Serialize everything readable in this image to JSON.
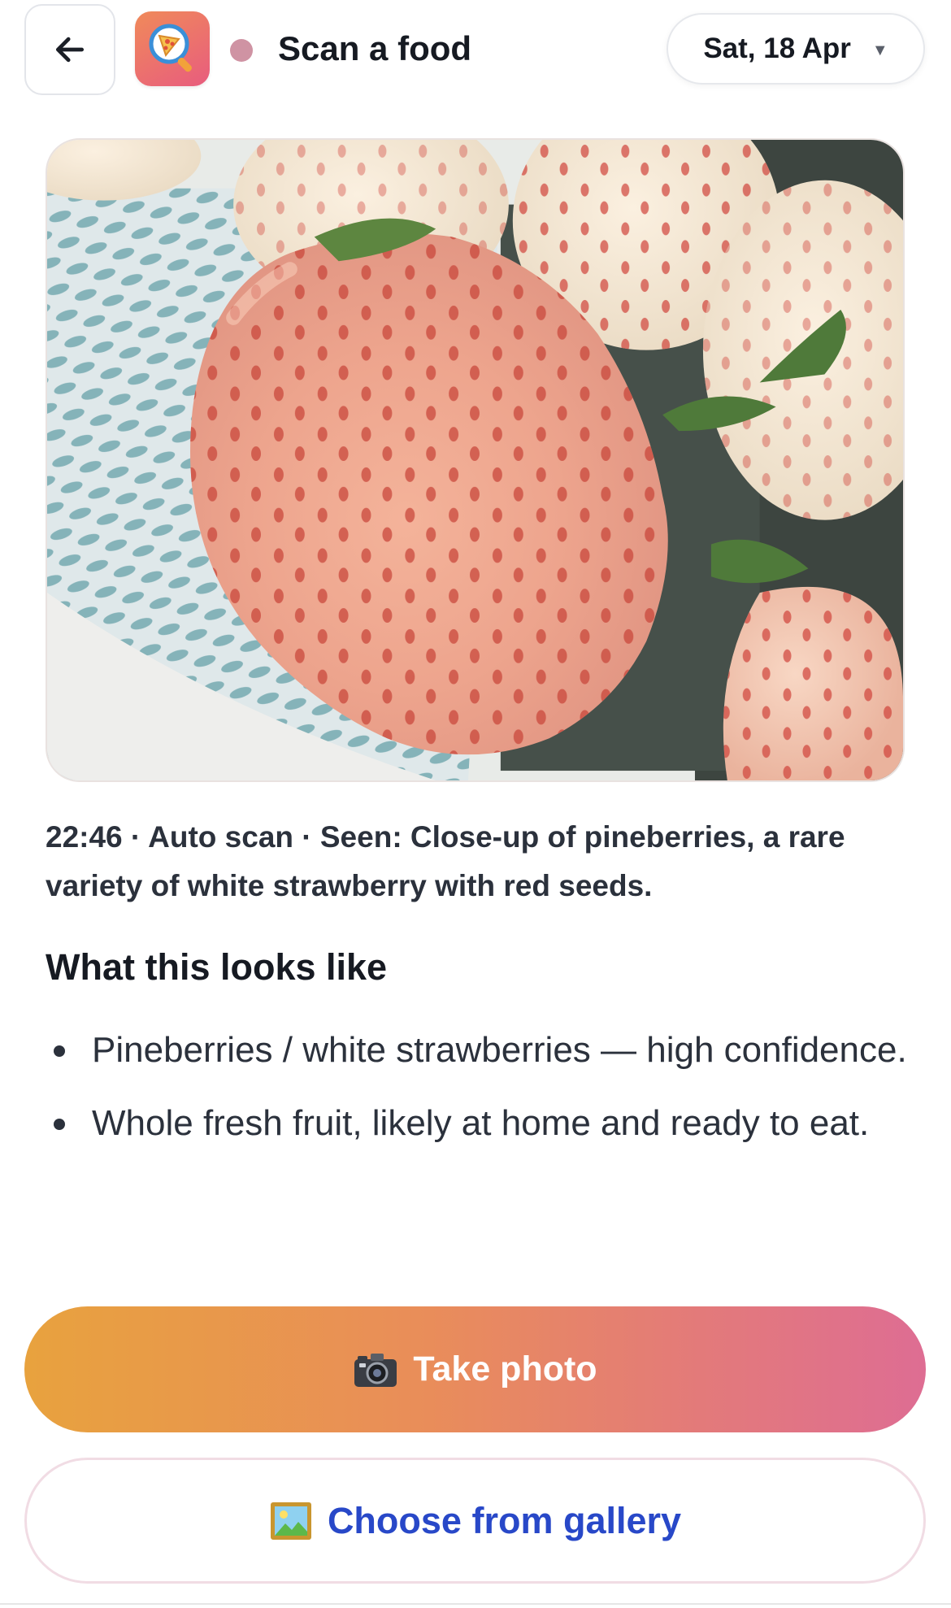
{
  "header": {
    "back_label": "Back",
    "title": "Scan a food",
    "date": "Sat, 18 Apr"
  },
  "scan": {
    "meta": "22:46 · Auto scan · Seen: Close-up of pineberries, a rare variety of white strawberry with red seeds.",
    "section_title": "What this looks like",
    "bullets": [
      "Pineberries / white strawberries — high confidence.",
      "Whole fresh fruit, likely at home and ready to eat."
    ]
  },
  "actions": {
    "take_photo_label": "Take photo",
    "gallery_label": "Choose from gallery"
  },
  "colors": {
    "accent_start": "#e8a23e",
    "accent_end": "#de6d93",
    "gallery_text": "#2848c8",
    "status_dot": "#cf93a3"
  },
  "icons": {
    "back": "arrow-left-icon",
    "app": "pizza-magnifier-icon",
    "camera": "camera-icon",
    "gallery": "framed-picture-icon",
    "date_caret": "caret-down-icon"
  }
}
